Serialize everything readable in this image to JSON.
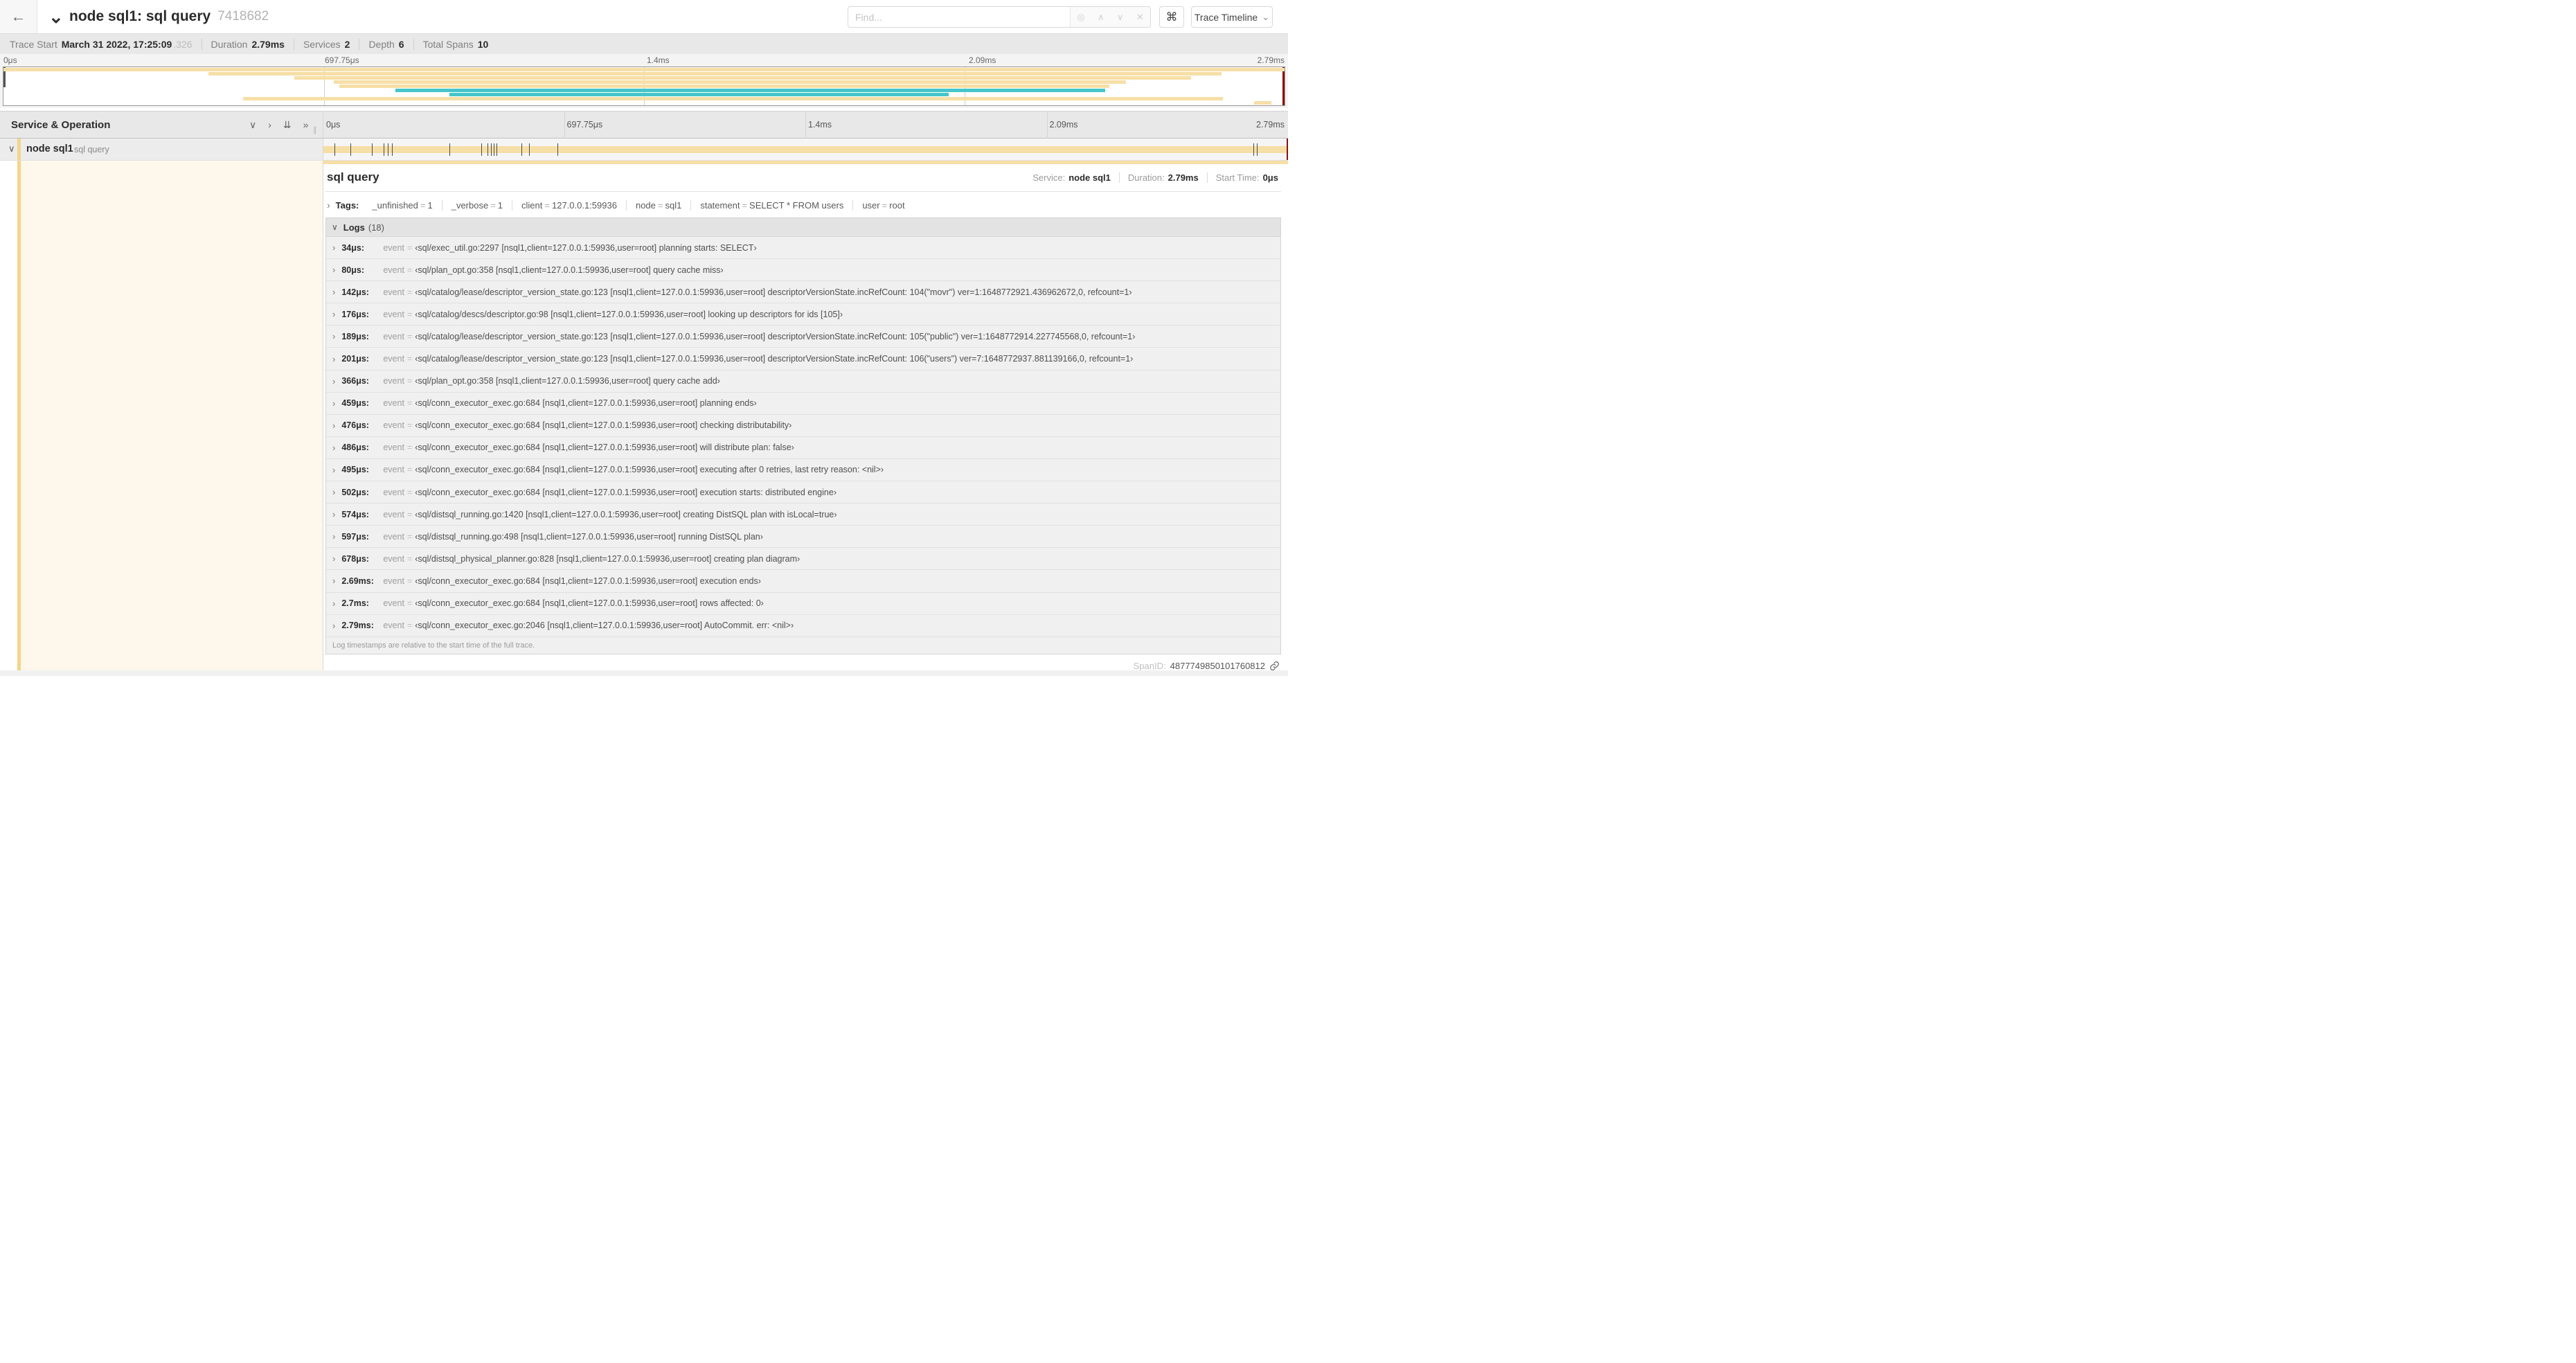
{
  "header": {
    "back_icon": "←",
    "collapse_icon": "⌄",
    "title": "node sql1: sql query",
    "trace_id": "7418682",
    "find_placeholder": "Find...",
    "find_icons": [
      {
        "name": "locate-icon",
        "glyph": "◎"
      },
      {
        "name": "prev-match-icon",
        "glyph": "∧"
      },
      {
        "name": "next-match-icon",
        "glyph": "∨"
      },
      {
        "name": "clear-icon",
        "glyph": "✕"
      }
    ],
    "shortcut_icon": "⌘",
    "view_selector": "Trace Timeline",
    "view_chevron": "⌄"
  },
  "meta": {
    "items": [
      {
        "label": "Trace Start",
        "value": "March 31 2022, 17:25:09",
        "suffix": ".326"
      },
      {
        "label": "Duration",
        "value": "2.79ms",
        "suffix": ""
      },
      {
        "label": "Services",
        "value": "2",
        "suffix": ""
      },
      {
        "label": "Depth",
        "value": "6",
        "suffix": ""
      },
      {
        "label": "Total Spans",
        "value": "10",
        "suffix": ""
      }
    ]
  },
  "timeline": {
    "labels": [
      {
        "text": "0μs",
        "pct": 0
      },
      {
        "text": "697.75μs",
        "pct": 25
      },
      {
        "text": "1.4ms",
        "pct": 50
      },
      {
        "text": "2.09ms",
        "pct": 75
      },
      {
        "text": "2.79ms",
        "pct": 100
      }
    ],
    "minimap_bars": [
      {
        "s": 0,
        "e": 100,
        "c": "tan"
      },
      {
        "s": 16,
        "e": 95.1,
        "c": "tan"
      },
      {
        "s": 22.7,
        "e": 92.7,
        "c": "tan"
      },
      {
        "s": 25.8,
        "e": 87.6,
        "c": "tan"
      },
      {
        "s": 26.2,
        "e": 86.3,
        "c": "tan"
      },
      {
        "s": 30.6,
        "e": 86,
        "c": "teal"
      },
      {
        "s": 34.8,
        "e": 73.8,
        "c": "teal"
      },
      {
        "s": 18.7,
        "e": 95.2,
        "c": "tan"
      },
      {
        "s": 97.6,
        "e": 99,
        "c": "tan"
      }
    ]
  },
  "columns": {
    "title": "Service & Operation",
    "collapse_one_icon": "∨",
    "expand_one_icon": "›",
    "collapse_all_icon": "⇊",
    "expand_all_icon": "»",
    "resizer_icon": "∥"
  },
  "span_row": {
    "chevron": "∨",
    "service": "node sql1",
    "operation": "sql query",
    "ticks_pct": [
      1.22,
      2.87,
      5.09,
      6.31,
      6.77,
      7.2,
      13.12,
      16.45,
      17.06,
      17.42,
      17.74,
      17.99,
      20.57,
      21.4,
      24.3,
      96.42,
      96.77
    ]
  },
  "detail": {
    "title": "sql query",
    "overview": [
      {
        "label": "Service:",
        "value": "node sql1"
      },
      {
        "label": "Duration:",
        "value": "2.79ms"
      },
      {
        "label": "Start Time:",
        "value": "0μs"
      }
    ],
    "tags_chevron": "›",
    "tags_label": "Tags:",
    "tags": [
      {
        "k": "_unfinished",
        "v": "1"
      },
      {
        "k": "_verbose",
        "v": "1"
      },
      {
        "k": "client",
        "v": "127.0.0.1:59936"
      },
      {
        "k": "node",
        "v": "sql1"
      },
      {
        "k": "statement",
        "v": "SELECT * FROM users"
      },
      {
        "k": "user",
        "v": "root"
      }
    ],
    "logs_chevron": "∨",
    "logs_label": "Logs",
    "logs_count": "(18)",
    "event_label": "event",
    "logs": [
      {
        "t": "34μs:",
        "v": "‹sql/exec_util.go:2297 [nsql1,client=127.0.0.1:59936,user=root] planning starts: SELECT›"
      },
      {
        "t": "80μs:",
        "v": "‹sql/plan_opt.go:358 [nsql1,client=127.0.0.1:59936,user=root] query cache miss›"
      },
      {
        "t": "142μs:",
        "v": "‹sql/catalog/lease/descriptor_version_state.go:123 [nsql1,client=127.0.0.1:59936,user=root] descriptorVersionState.incRefCount: 104(\"movr\") ver=1:1648772921.436962672,0, refcount=1›"
      },
      {
        "t": "176μs:",
        "v": "‹sql/catalog/descs/descriptor.go:98 [nsql1,client=127.0.0.1:59936,user=root] looking up descriptors for ids [105]›"
      },
      {
        "t": "189μs:",
        "v": "‹sql/catalog/lease/descriptor_version_state.go:123 [nsql1,client=127.0.0.1:59936,user=root] descriptorVersionState.incRefCount: 105(\"public\") ver=1:1648772914.227745568,0, refcount=1›"
      },
      {
        "t": "201μs:",
        "v": "‹sql/catalog/lease/descriptor_version_state.go:123 [nsql1,client=127.0.0.1:59936,user=root] descriptorVersionState.incRefCount: 106(\"users\") ver=7:1648772937.881139166,0, refcount=1›"
      },
      {
        "t": "366μs:",
        "v": "‹sql/plan_opt.go:358 [nsql1,client=127.0.0.1:59936,user=root] query cache add›"
      },
      {
        "t": "459μs:",
        "v": "‹sql/conn_executor_exec.go:684 [nsql1,client=127.0.0.1:59936,user=root] planning ends›"
      },
      {
        "t": "476μs:",
        "v": "‹sql/conn_executor_exec.go:684 [nsql1,client=127.0.0.1:59936,user=root] checking distributability›"
      },
      {
        "t": "486μs:",
        "v": "‹sql/conn_executor_exec.go:684 [nsql1,client=127.0.0.1:59936,user=root] will distribute plan: false›"
      },
      {
        "t": "495μs:",
        "v": "‹sql/conn_executor_exec.go:684 [nsql1,client=127.0.0.1:59936,user=root] executing after 0 retries, last retry reason: <nil>›"
      },
      {
        "t": "502μs:",
        "v": "‹sql/conn_executor_exec.go:684 [nsql1,client=127.0.0.1:59936,user=root] execution starts: distributed engine›"
      },
      {
        "t": "574μs:",
        "v": "‹sql/distsql_running.go:1420 [nsql1,client=127.0.0.1:59936,user=root] creating DistSQL plan with isLocal=true›"
      },
      {
        "t": "597μs:",
        "v": "‹sql/distsql_running.go:498 [nsql1,client=127.0.0.1:59936,user=root] running DistSQL plan›"
      },
      {
        "t": "678μs:",
        "v": "‹sql/distsql_physical_planner.go:828 [nsql1,client=127.0.0.1:59936,user=root] creating plan diagram›"
      },
      {
        "t": "2.69ms:",
        "v": "‹sql/conn_executor_exec.go:684 [nsql1,client=127.0.0.1:59936,user=root] execution ends›"
      },
      {
        "t": "2.7ms:",
        "v": "‹sql/conn_executor_exec.go:684 [nsql1,client=127.0.0.1:59936,user=root] rows affected: 0›"
      },
      {
        "t": "2.79ms:",
        "v": "‹sql/conn_executor_exec.go:2046 [nsql1,client=127.0.0.1:59936,user=root] AutoCommit. err: <nil>›"
      }
    ],
    "logs_footer": "Log timestamps are relative to the start time of the full trace.",
    "spanid_label": "SpanID:",
    "spanid": "4877749850101760812"
  },
  "colors": {
    "tan": "#f6dfa6",
    "tan_dark": "#f3d58b",
    "teal": "#45c6ca",
    "cream": "#fef7eb",
    "red_handle": "#8c1010"
  }
}
